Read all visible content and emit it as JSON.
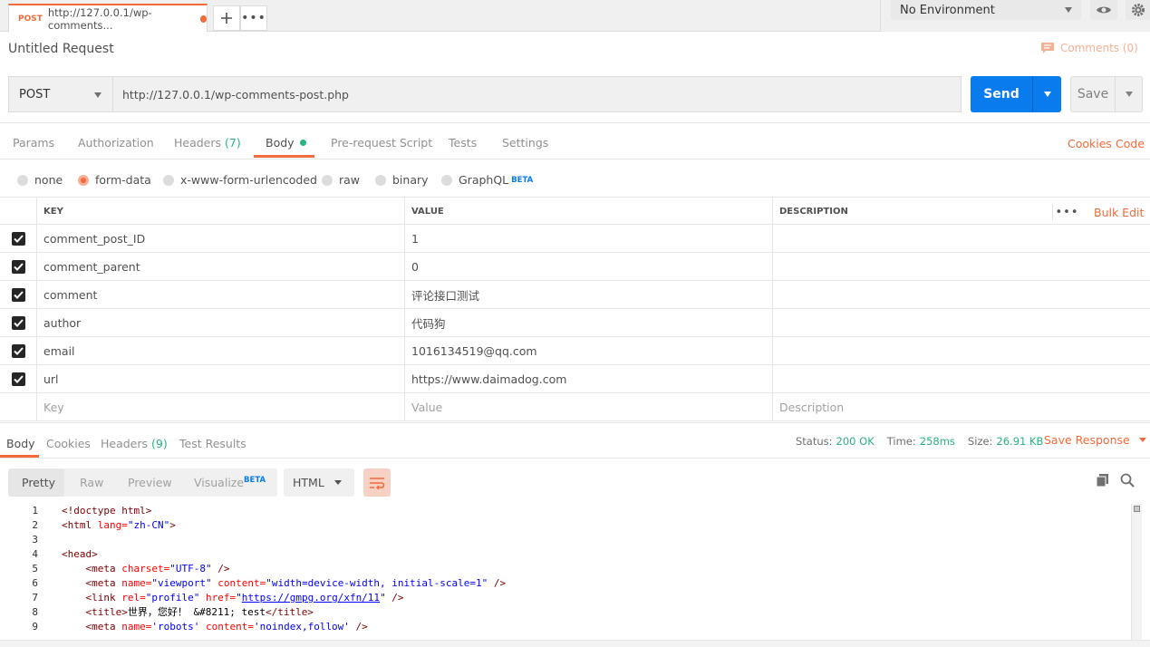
{
  "tabs": [
    {
      "method": "POST",
      "label": "http://127.0.0.1/wp-comments..."
    }
  ],
  "environment": {
    "selected": "No Environment"
  },
  "request": {
    "title": "Untitled Request",
    "comments": "Comments (0)",
    "method": "POST",
    "url": "http://127.0.0.1/wp-comments-post.php",
    "send": "Send",
    "save": "Save"
  },
  "request_tabs": {
    "params": "Params",
    "authorization": "Authorization",
    "headers": "Headers",
    "headers_count": "(7)",
    "body": "Body",
    "prerequest": "Pre-request Script",
    "tests": "Tests",
    "settings": "Settings",
    "cookies": "Cookies",
    "code": "Code"
  },
  "body_types": {
    "none": "none",
    "form_data": "form-data",
    "urlencoded": "x-www-form-urlencoded",
    "raw": "raw",
    "binary": "binary",
    "graphql": "GraphQL",
    "beta": "BETA",
    "selected": "form-data"
  },
  "table": {
    "columns": {
      "key": "KEY",
      "value": "VALUE",
      "description": "DESCRIPTION"
    },
    "bulk_edit": "Bulk Edit",
    "rows": [
      {
        "key": "comment_post_ID",
        "value": "1",
        "checked": true
      },
      {
        "key": "comment_parent",
        "value": "0",
        "checked": true
      },
      {
        "key": "comment",
        "value": "评论接口测试",
        "checked": true
      },
      {
        "key": "author",
        "value": "代码狗",
        "checked": true
      },
      {
        "key": "email",
        "value": "1016134519@qq.com",
        "checked": true
      },
      {
        "key": "url",
        "value": "https://www.daimadog.com",
        "checked": true
      }
    ],
    "placeholders": {
      "key": "Key",
      "value": "Value",
      "description": "Description"
    }
  },
  "response": {
    "tabs": {
      "body": "Body",
      "cookies": "Cookies",
      "headers": "Headers",
      "headers_count": "(9)",
      "test_results": "Test Results"
    },
    "status_label": "Status:",
    "status": "200 OK",
    "time_label": "Time:",
    "time": "258ms",
    "size_label": "Size:",
    "size": "26.91 KB",
    "save_response": "Save Response",
    "views": {
      "pretty": "Pretty",
      "raw": "Raw",
      "preview": "Preview",
      "visualize": "Visualize",
      "beta": "BETA"
    },
    "language": "HTML",
    "code_lines": [
      "1",
      "2",
      "3",
      "4",
      "5",
      "6",
      "7",
      "8",
      "9"
    ]
  },
  "colors": {
    "accent": "#f26b3a",
    "primary": "#097bed",
    "success": "#26b47f"
  }
}
